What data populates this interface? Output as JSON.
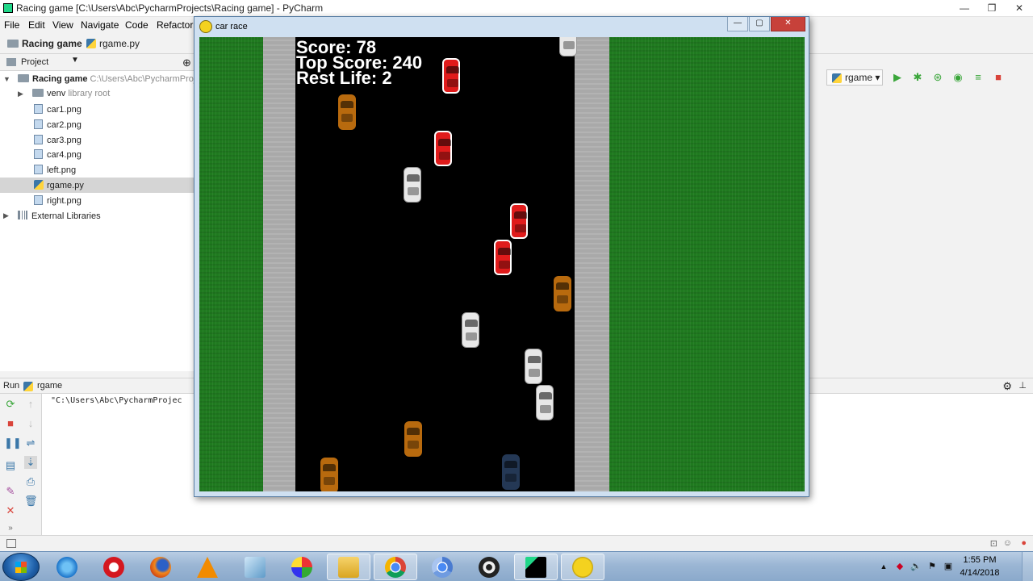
{
  "ide": {
    "window_title": "Racing game [C:\\Users\\Abc\\PycharmProjects\\Racing game] - PyCharm",
    "menu": [
      "File",
      "Edit",
      "View",
      "Navigate",
      "Code",
      "Refactor"
    ],
    "breadcrumb": {
      "project": "Racing game",
      "file": "rgame.py"
    },
    "run_config": "rgame",
    "project_panel": {
      "title": "Project",
      "tree": [
        {
          "label": "Racing game",
          "hint": "C:\\Users\\Abc\\PycharmProjects",
          "icon": "folder-icon"
        },
        {
          "label": "venv",
          "hint": "library root",
          "icon": "folder-icon"
        },
        {
          "label": "car1.png",
          "icon": "image-file-icon"
        },
        {
          "label": "car2.png",
          "icon": "image-file-icon"
        },
        {
          "label": "car3.png",
          "icon": "image-file-icon"
        },
        {
          "label": "car4.png",
          "icon": "image-file-icon"
        },
        {
          "label": "left.png",
          "icon": "image-file-icon"
        },
        {
          "label": "rgame.py",
          "icon": "python-file-icon",
          "selected": true
        },
        {
          "label": "right.png",
          "icon": "image-file-icon"
        },
        {
          "label": "External Libraries",
          "icon": "library-icon"
        }
      ]
    },
    "run_panel": {
      "label": "Run",
      "config": "rgame",
      "console_line": "\"C:\\Users\\Abc\\PycharmProjec"
    }
  },
  "game": {
    "window_title": "car race",
    "hud": {
      "score": "Score: 78",
      "top_score": "Top Score: 240",
      "rest_life": "Rest Life: 2"
    },
    "colors": {
      "grass": "#1f7a1f",
      "road": "#000000",
      "curb": "#a9a9a9"
    }
  },
  "taskbar": {
    "apps": [
      "internet-explorer-icon",
      "opera-icon",
      "firefox-icon",
      "vlc-icon",
      "notepad-icon",
      "paint-icon",
      "explorer-icon",
      "chrome-icon",
      "chromium-icon",
      "media-player-icon",
      "pycharm-icon",
      "pygame-icon"
    ],
    "clock_time": "1:55 PM",
    "clock_date": "4/14/2018"
  }
}
